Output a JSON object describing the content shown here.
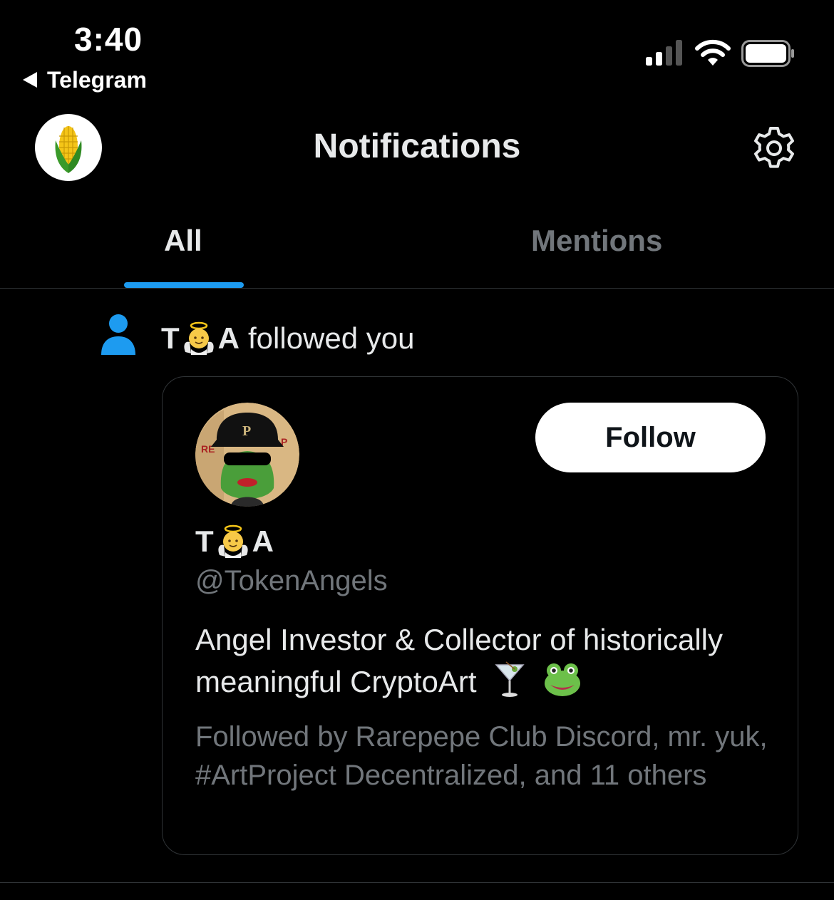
{
  "status_bar": {
    "time": "3:40",
    "back_app": "Telegram"
  },
  "header": {
    "title": "Notifications",
    "avatar_icon": "corn-icon",
    "settings_icon": "gear-icon"
  },
  "tabs": [
    {
      "label": "All",
      "active": true
    },
    {
      "label": "Mentions",
      "active": false
    }
  ],
  "notification": {
    "icon": "person-icon",
    "actor_prefix": "T",
    "actor_emoji": "baby-angel-emoji",
    "actor_suffix": "A",
    "action_text": "followed you",
    "card": {
      "follow_button_label": "Follow",
      "name_prefix": "T",
      "name_suffix": "A",
      "handle": "@TokenAngels",
      "bio": "Angel Investor & Collector of historically meaningful CryptoArt",
      "bio_emojis": [
        "cocktail-glass-emoji",
        "frog-face-emoji"
      ],
      "followed_by": "Followed by Rarepepe Club Discord, mr. yuk, #ArtProject Decentralized, and 11 others"
    }
  },
  "colors": {
    "background": "#000000",
    "primary_text": "#e7e9ea",
    "secondary_text": "#71767b",
    "accent": "#1d9bf0",
    "divider": "#2f3336"
  }
}
